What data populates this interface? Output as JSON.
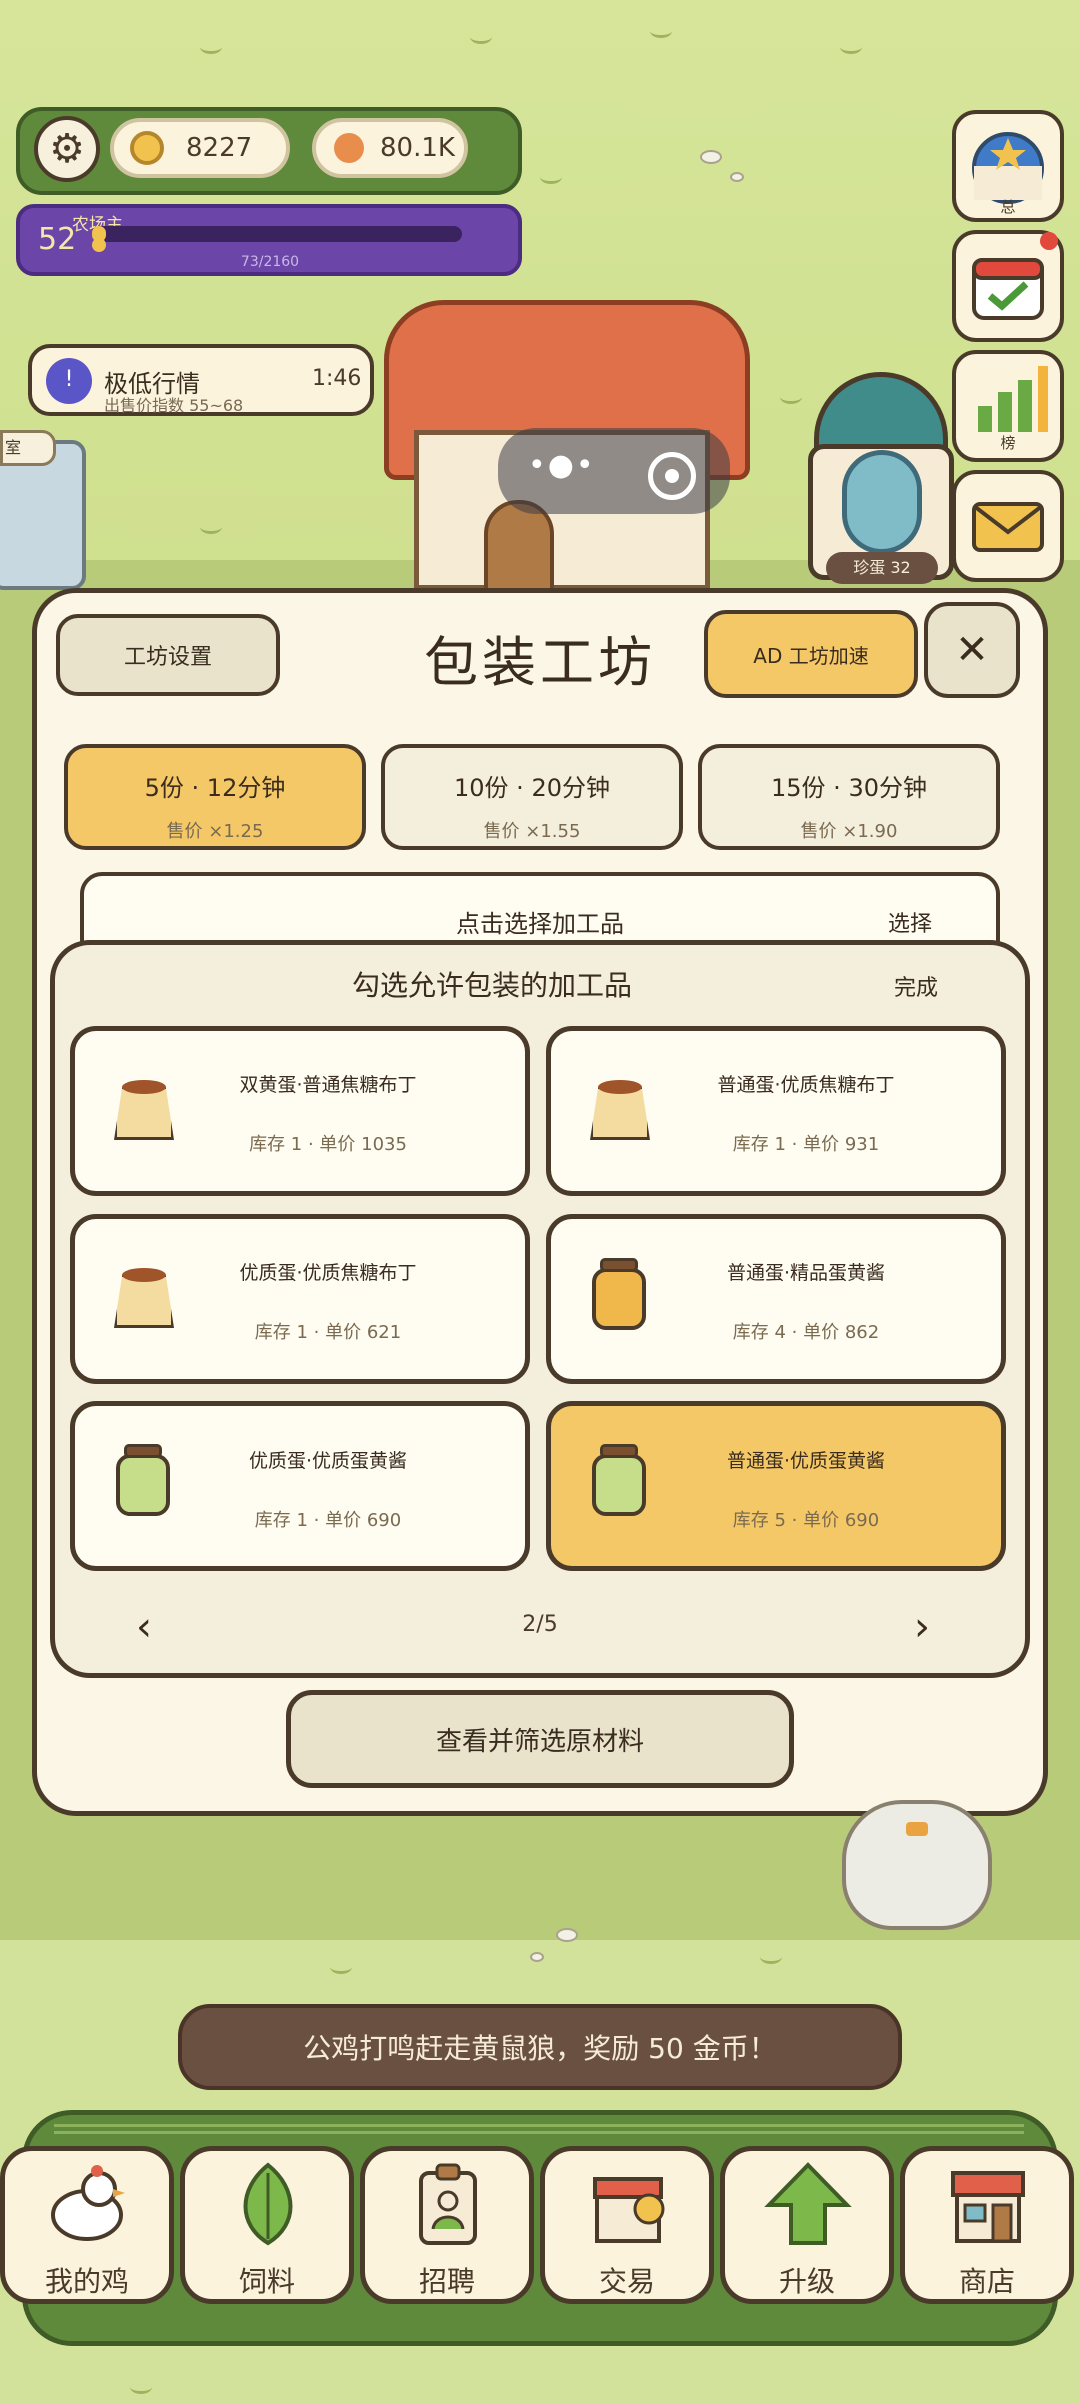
{
  "hud": {
    "coins": "8227",
    "gems": "80.1K",
    "level": "52",
    "level_title": "农场主",
    "xp_text": "73/2160",
    "xp_progress": 0.034
  },
  "market": {
    "title": "极低行情",
    "subtitle": "出售价指数 55~68",
    "timer": "1:46"
  },
  "side": {
    "badge_label": "总",
    "rank_label": "榜"
  },
  "scene": {
    "left_tag": "室",
    "clock_label": "珍蛋 32"
  },
  "panel": {
    "title": "包装工坊",
    "settings_label": "工坊设置",
    "boost_label": "AD 工坊加速",
    "close_label": "✕",
    "options": [
      {
        "main": "5份 · 12分钟",
        "sub": "售价 ×1.25",
        "selected": true
      },
      {
        "main": "10份 · 20分钟",
        "sub": "售价 ×1.55",
        "selected": false
      },
      {
        "main": "15份 · 30分钟",
        "sub": "售价 ×1.90",
        "selected": false
      }
    ],
    "select_text": "点击选择加工品",
    "select_btn": "选择"
  },
  "picker": {
    "title": "勾选允许包装的加工品",
    "done": "完成",
    "items": [
      {
        "name": "双黄蛋·普通焦糖布丁",
        "meta": "库存 1 · 单价 1035",
        "icon": "pudding-icon",
        "selected": false
      },
      {
        "name": "普通蛋·优质焦糖布丁",
        "meta": "库存 1 · 单价 931",
        "icon": "pudding-icon",
        "selected": false
      },
      {
        "name": "优质蛋·优质焦糖布丁",
        "meta": "库存 1 · 单价 621",
        "icon": "pudding-icon",
        "selected": false
      },
      {
        "name": "普通蛋·精品蛋黄酱",
        "meta": "库存 4 · 单价 862",
        "icon": "jar-icon",
        "selected": false
      },
      {
        "name": "优质蛋·优质蛋黄酱",
        "meta": "库存 1 · 单价 690",
        "icon": "jar-icon",
        "selected": false
      },
      {
        "name": "普通蛋·优质蛋黄酱",
        "meta": "库存 5 · 单价 690",
        "icon": "jar-icon",
        "selected": true
      }
    ],
    "page": "2/5",
    "prev": "‹",
    "next": "›"
  },
  "filter_label": "查看并筛选原材料",
  "toast": "公鸡打鸣赶走黄鼠狼，奖励 50 金币！",
  "nav": [
    {
      "label": "我的鸡",
      "icon": "chicken-icon"
    },
    {
      "label": "饲料",
      "icon": "leaf-icon"
    },
    {
      "label": "招聘",
      "icon": "badge-icon"
    },
    {
      "label": "交易",
      "icon": "shop-coin-icon"
    },
    {
      "label": "升级",
      "icon": "arrow-up-icon"
    },
    {
      "label": "商店",
      "icon": "store-icon"
    }
  ],
  "colors": {
    "accent": "#f4c867",
    "ink": "#4a3a2a",
    "grass": "#cfe08f",
    "nav_green": "#5f8a3c",
    "level_purple": "#6b46a8"
  }
}
